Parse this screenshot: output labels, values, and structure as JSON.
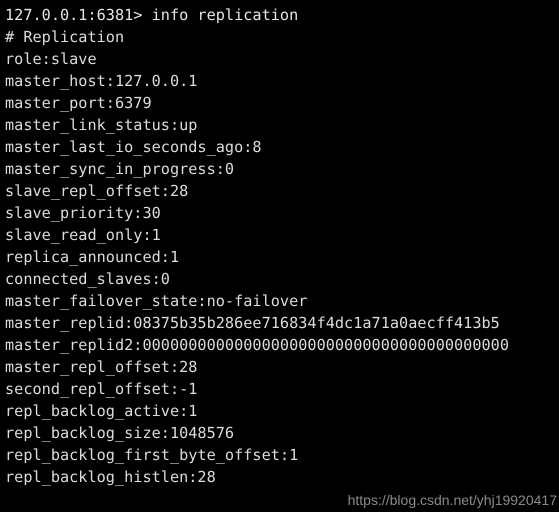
{
  "terminal": {
    "app": "redis-cli",
    "background_color": "#000000",
    "text_color": "#dcdcdc",
    "prompt": "127.0.0.1:6381>",
    "command": "info replication",
    "prompt_line": "127.0.0.1:6381> info replication",
    "lines": [
      "127.0.0.1:6381> info replication",
      "# Replication",
      "role:slave",
      "master_host:127.0.0.1",
      "master_port:6379",
      "master_link_status:up",
      "master_last_io_seconds_ago:8",
      "master_sync_in_progress:0",
      "slave_repl_offset:28",
      "slave_priority:30",
      "slave_read_only:1",
      "replica_announced:1",
      "connected_slaves:0",
      "master_failover_state:no-failover",
      "master_replid:08375b35b286ee716834f4dc1a71a0aecff413b5",
      "master_replid2:0000000000000000000000000000000000000000",
      "master_repl_offset:28",
      "second_repl_offset:-1",
      "repl_backlog_active:1",
      "repl_backlog_size:1048576",
      "repl_backlog_first_byte_offset:1",
      "repl_backlog_histlen:28"
    ],
    "fields": {
      "section_header": "# Replication",
      "role": "slave",
      "master_host": "127.0.0.1",
      "master_port": "6379",
      "master_link_status": "up",
      "master_last_io_seconds_ago": "8",
      "master_sync_in_progress": "0",
      "slave_repl_offset": "28",
      "slave_priority": "30",
      "slave_read_only": "1",
      "replica_announced": "1",
      "connected_slaves": "0",
      "master_failover_state": "no-failover",
      "master_replid": "08375b35b286ee716834f4dc1a71a0aecff413b5",
      "master_replid2": "0000000000000000000000000000000000000000",
      "master_repl_offset": "28",
      "second_repl_offset": "-1",
      "repl_backlog_active": "1",
      "repl_backlog_size": "1048576",
      "repl_backlog_first_byte_offset": "1",
      "repl_backlog_histlen": "28"
    }
  },
  "watermark": {
    "text": "https://blog.csdn.net/yhj19920417",
    "color": "#8a8a8a"
  }
}
